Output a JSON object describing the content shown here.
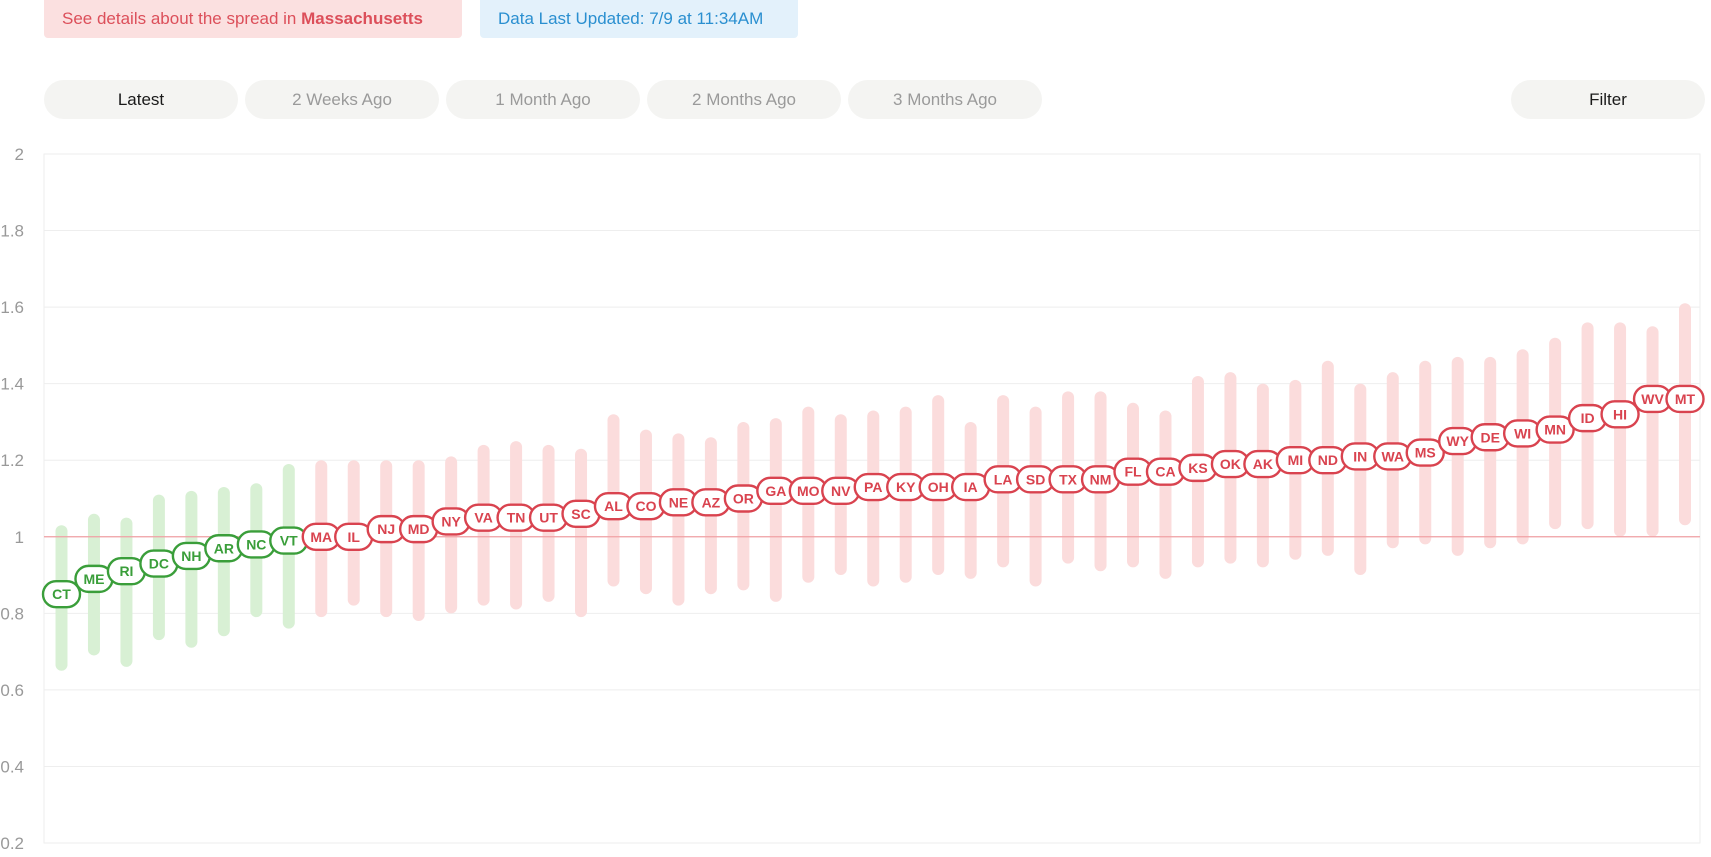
{
  "banner": {
    "spread_prefix": "See details about the spread in ",
    "spread_state": "Massachusetts",
    "updated": "Data Last Updated: 7/9 at 11:34AM"
  },
  "tabs": [
    {
      "label": "Latest",
      "active": true
    },
    {
      "label": "2 Weeks Ago",
      "active": false
    },
    {
      "label": "1 Month Ago",
      "active": false
    },
    {
      "label": "2 Months Ago",
      "active": false
    },
    {
      "label": "3 Months Ago",
      "active": false
    }
  ],
  "filter_label": "Filter",
  "colors": {
    "below": "#3a9e3a",
    "below_range": "#d8f0d4",
    "above": "#d9434f",
    "above_range": "#fbdcdc",
    "reference_line": "#f0a0a4",
    "grid": "#eeeeee"
  },
  "chart_data": {
    "type": "scatter",
    "title": "",
    "xlabel": "",
    "ylabel": "",
    "ylim": [
      0.2,
      2.0
    ],
    "yticks": [
      2,
      1.8,
      1.6,
      1.4,
      1.2,
      1,
      0.8,
      0.6,
      0.4,
      0.2
    ],
    "reference_line": 1.0,
    "states": [
      {
        "code": "CT",
        "value": 0.85,
        "low": 0.65,
        "high": 1.03
      },
      {
        "code": "ME",
        "value": 0.89,
        "low": 0.69,
        "high": 1.06
      },
      {
        "code": "RI",
        "value": 0.91,
        "low": 0.66,
        "high": 1.05
      },
      {
        "code": "DC",
        "value": 0.93,
        "low": 0.73,
        "high": 1.11
      },
      {
        "code": "NH",
        "value": 0.95,
        "low": 0.71,
        "high": 1.12
      },
      {
        "code": "AR",
        "value": 0.97,
        "low": 0.74,
        "high": 1.13
      },
      {
        "code": "NC",
        "value": 0.98,
        "low": 0.79,
        "high": 1.14
      },
      {
        "code": "VT",
        "value": 0.99,
        "low": 0.76,
        "high": 1.19
      },
      {
        "code": "MA",
        "value": 1.0,
        "low": 0.79,
        "high": 1.2
      },
      {
        "code": "IL",
        "value": 1.0,
        "low": 0.82,
        "high": 1.2
      },
      {
        "code": "NJ",
        "value": 1.02,
        "low": 0.79,
        "high": 1.2
      },
      {
        "code": "MD",
        "value": 1.02,
        "low": 0.78,
        "high": 1.2
      },
      {
        "code": "NY",
        "value": 1.04,
        "low": 0.8,
        "high": 1.21
      },
      {
        "code": "VA",
        "value": 1.05,
        "low": 0.82,
        "high": 1.24
      },
      {
        "code": "TN",
        "value": 1.05,
        "low": 0.81,
        "high": 1.25
      },
      {
        "code": "UT",
        "value": 1.05,
        "low": 0.83,
        "high": 1.24
      },
      {
        "code": "SC",
        "value": 1.06,
        "low": 0.79,
        "high": 1.23
      },
      {
        "code": "AL",
        "value": 1.08,
        "low": 0.87,
        "high": 1.32
      },
      {
        "code": "CO",
        "value": 1.08,
        "low": 0.85,
        "high": 1.28
      },
      {
        "code": "NE",
        "value": 1.09,
        "low": 0.82,
        "high": 1.27
      },
      {
        "code": "AZ",
        "value": 1.09,
        "low": 0.85,
        "high": 1.26
      },
      {
        "code": "OR",
        "value": 1.1,
        "low": 0.86,
        "high": 1.3
      },
      {
        "code": "GA",
        "value": 1.12,
        "low": 0.83,
        "high": 1.31
      },
      {
        "code": "MO",
        "value": 1.12,
        "low": 0.88,
        "high": 1.34
      },
      {
        "code": "NV",
        "value": 1.12,
        "low": 0.9,
        "high": 1.32
      },
      {
        "code": "PA",
        "value": 1.13,
        "low": 0.87,
        "high": 1.33
      },
      {
        "code": "KY",
        "value": 1.13,
        "low": 0.88,
        "high": 1.34
      },
      {
        "code": "OH",
        "value": 1.13,
        "low": 0.9,
        "high": 1.37
      },
      {
        "code": "IA",
        "value": 1.13,
        "low": 0.89,
        "high": 1.3
      },
      {
        "code": "LA",
        "value": 1.15,
        "low": 0.92,
        "high": 1.37
      },
      {
        "code": "SD",
        "value": 1.15,
        "low": 0.87,
        "high": 1.34
      },
      {
        "code": "TX",
        "value": 1.15,
        "low": 0.93,
        "high": 1.38
      },
      {
        "code": "NM",
        "value": 1.15,
        "low": 0.91,
        "high": 1.38
      },
      {
        "code": "FL",
        "value": 1.17,
        "low": 0.92,
        "high": 1.35
      },
      {
        "code": "CA",
        "value": 1.17,
        "low": 0.89,
        "high": 1.33
      },
      {
        "code": "KS",
        "value": 1.18,
        "low": 0.92,
        "high": 1.42
      },
      {
        "code": "OK",
        "value": 1.19,
        "low": 0.93,
        "high": 1.43
      },
      {
        "code": "AK",
        "value": 1.19,
        "low": 0.92,
        "high": 1.4
      },
      {
        "code": "MI",
        "value": 1.2,
        "low": 0.94,
        "high": 1.41
      },
      {
        "code": "ND",
        "value": 1.2,
        "low": 0.95,
        "high": 1.46
      },
      {
        "code": "IN",
        "value": 1.21,
        "low": 0.9,
        "high": 1.4
      },
      {
        "code": "WA",
        "value": 1.21,
        "low": 0.97,
        "high": 1.43
      },
      {
        "code": "MS",
        "value": 1.22,
        "low": 0.98,
        "high": 1.46
      },
      {
        "code": "WY",
        "value": 1.25,
        "low": 0.95,
        "high": 1.47
      },
      {
        "code": "DE",
        "value": 1.26,
        "low": 0.97,
        "high": 1.47
      },
      {
        "code": "WI",
        "value": 1.27,
        "low": 0.98,
        "high": 1.49
      },
      {
        "code": "MN",
        "value": 1.28,
        "low": 1.02,
        "high": 1.52
      },
      {
        "code": "ID",
        "value": 1.31,
        "low": 1.02,
        "high": 1.56
      },
      {
        "code": "HI",
        "value": 1.32,
        "low": 1.0,
        "high": 1.56
      },
      {
        "code": "WV",
        "value": 1.36,
        "low": 1.0,
        "high": 1.55
      },
      {
        "code": "MT",
        "value": 1.36,
        "low": 1.03,
        "high": 1.61
      }
    ]
  }
}
